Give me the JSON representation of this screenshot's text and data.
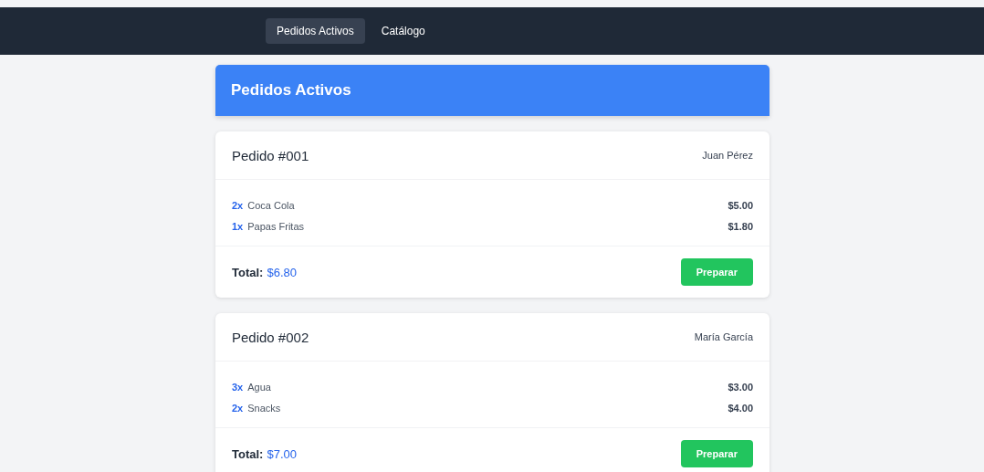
{
  "nav": {
    "tabs": [
      {
        "label": "Pedidos Activos",
        "selected": true
      },
      {
        "label": "Catálogo",
        "selected": false
      }
    ]
  },
  "header": {
    "title": "Pedidos Activos"
  },
  "orders": [
    {
      "title": "Pedido #001",
      "customer": "Juan Pérez",
      "items": [
        {
          "qty": "2x",
          "name": "Coca Cola",
          "price": "$5.00"
        },
        {
          "qty": "1x",
          "name": "Papas Fritas",
          "price": "$1.80"
        }
      ],
      "total_label": "Total:",
      "total": "$6.80",
      "button": "Preparar"
    },
    {
      "title": "Pedido #002",
      "customer": "María García",
      "items": [
        {
          "qty": "3x",
          "name": "Agua",
          "price": "$3.00"
        },
        {
          "qty": "2x",
          "name": "Snacks",
          "price": "$4.00"
        }
      ],
      "total_label": "Total:",
      "total": "$7.00",
      "button": "Preparar"
    }
  ]
}
